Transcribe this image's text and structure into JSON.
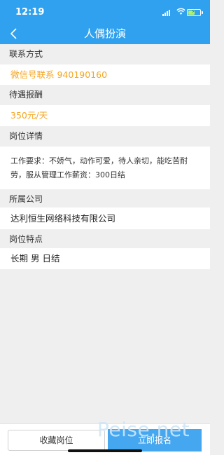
{
  "status": {
    "time": "12:19"
  },
  "nav": {
    "title": "人偶扮演"
  },
  "sections": {
    "contact": {
      "label": "联系方式",
      "value": "微信号联系   940190160"
    },
    "pay": {
      "label": "待遇报酬",
      "value": "350元/天"
    },
    "details": {
      "label": "岗位详情",
      "value": "工作要求：不娇气，动作可爱，待人亲切，能吃苦耐劳，服从管理工作薪资：300日结"
    },
    "company": {
      "label": "所属公司",
      "value": "达利恒生网络科技有限公司"
    },
    "features": {
      "label": "岗位特点",
      "value": "长期   男   日结"
    }
  },
  "footer": {
    "favorite_label": "收藏岗位",
    "apply_label": "立即报名"
  },
  "watermark": "Peise.net",
  "colors": {
    "header": "#2fa1ee",
    "accent": "#f5a623",
    "apply": "#45a7f0"
  }
}
